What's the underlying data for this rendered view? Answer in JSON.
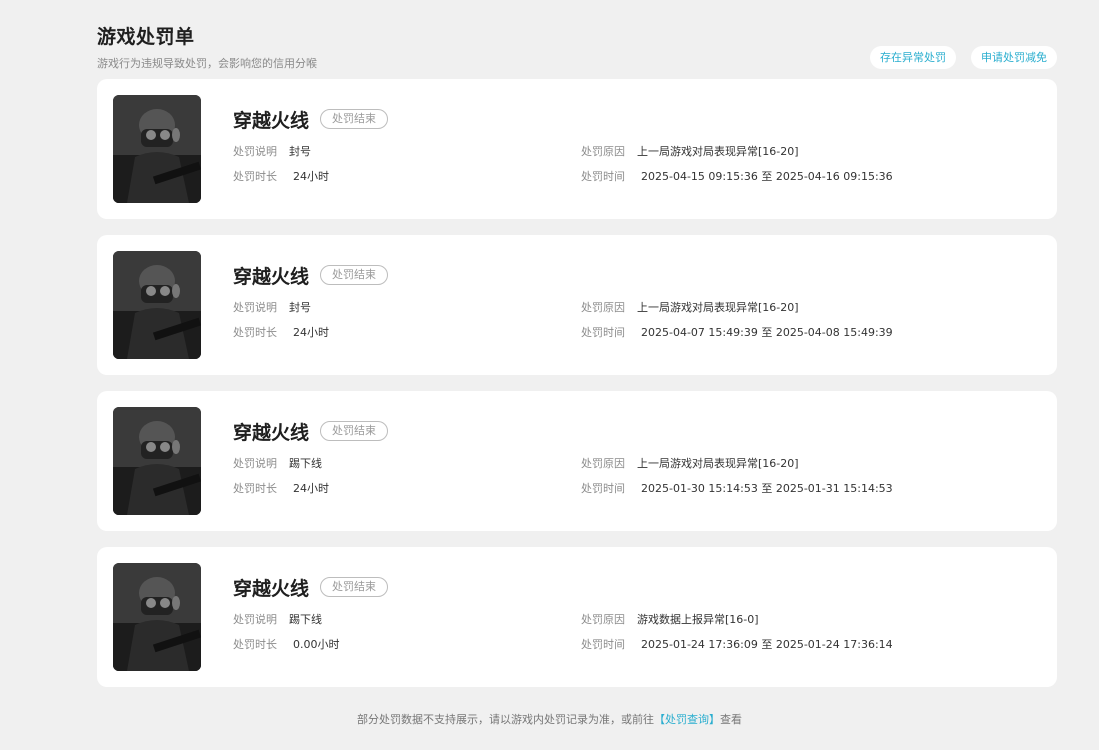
{
  "header": {
    "title": "游戏处罚单",
    "subtitle": "游戏行为违规导致处罚，会影响您的信用分喉",
    "actions": [
      "存在异常处罚",
      "申请处罚减免"
    ]
  },
  "labels": {
    "desc": "处罚说明",
    "duration": "处罚时长",
    "reason": "处罚原因",
    "time": "处罚时间"
  },
  "records": [
    {
      "game": "穿越火线",
      "status": "处罚结束",
      "desc": "封号",
      "duration": "24小时",
      "reason": "上一局游戏对局表现异常[16-20]",
      "time": "2025-04-15 09:15:36 至 2025-04-16 09:15:36"
    },
    {
      "game": "穿越火线",
      "status": "处罚结束",
      "desc": "封号",
      "duration": "24小时",
      "reason": "上一局游戏对局表现异常[16-20]",
      "time": "2025-04-07 15:49:39 至 2025-04-08 15:49:39"
    },
    {
      "game": "穿越火线",
      "status": "处罚结束",
      "desc": "踢下线",
      "duration": "24小时",
      "reason": "上一局游戏对局表现异常[16-20]",
      "time": "2025-01-30 15:14:53 至 2025-01-31 15:14:53"
    },
    {
      "game": "穿越火线",
      "status": "处罚结束",
      "desc": "踢下线",
      "duration": "0.00小时",
      "reason": "游戏数据上报异常[16-0]",
      "time": "2025-01-24 17:36:09 至 2025-01-24 17:36:14"
    }
  ],
  "footer": {
    "prefix": "部分处罚数据不支持展示，请以游戏内处罚记录为准，或前往",
    "link": "【处罚查询】",
    "suffix": "查看"
  }
}
